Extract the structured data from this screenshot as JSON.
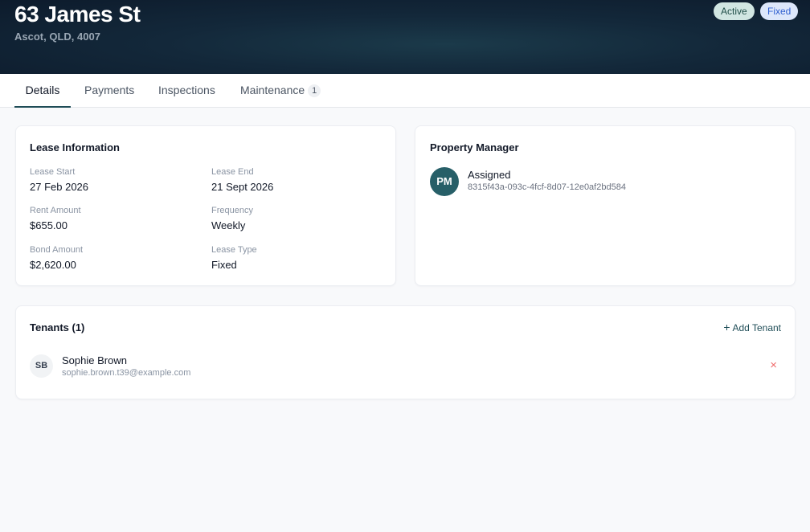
{
  "property": {
    "address": "63 James St",
    "location": "Ascot, QLD, 4007",
    "status_badge": "Active",
    "lease_badge": "Fixed"
  },
  "tabs": [
    {
      "label": "Details",
      "active": true
    },
    {
      "label": "Payments"
    },
    {
      "label": "Inspections"
    },
    {
      "label": "Maintenance",
      "count": "1"
    }
  ],
  "lease": {
    "title": "Lease Information",
    "fields": [
      {
        "label": "Lease Start",
        "value": "27 Feb 2026"
      },
      {
        "label": "Lease End",
        "value": "21 Sept 2026"
      },
      {
        "label": "Rent Amount",
        "value": "$655.00"
      },
      {
        "label": "Frequency",
        "value": "Weekly"
      },
      {
        "label": "Bond Amount",
        "value": "$2,620.00"
      },
      {
        "label": "Lease Type",
        "value": "Fixed"
      }
    ]
  },
  "property_manager": {
    "title": "Property Manager",
    "initials": "PM",
    "status": "Assigned",
    "id": "8315f43a-093c-4fcf-8d07-12e0af2bd584"
  },
  "tenants": {
    "title": "Tenants (1)",
    "add_label": "Add Tenant",
    "add_icon": "+",
    "remove_icon": "×",
    "items": [
      {
        "initials": "SB",
        "name": "Sophie Brown",
        "email": "sophie.brown.t39@example.com"
      }
    ]
  },
  "colors": {
    "accent": "#1f4d57",
    "badge_active_bg": "#d1e6e2",
    "badge_fixed_bg": "#dde7fb",
    "danger": "#ef6b6b"
  }
}
